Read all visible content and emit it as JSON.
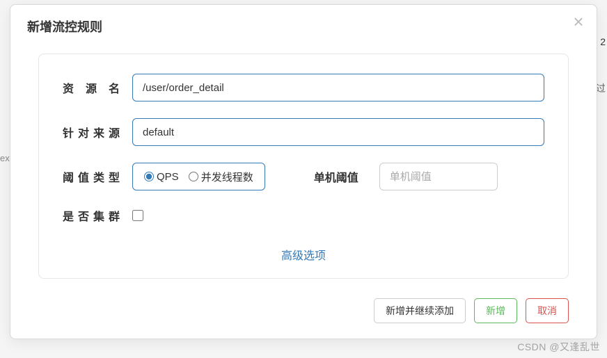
{
  "background": {
    "rightText1": "2",
    "rightText2": "过",
    "leftText": "ex"
  },
  "modal": {
    "title": "新增流控规则",
    "closeGlyph": "×",
    "form": {
      "resource": {
        "label": "资源名",
        "value": "/user/order_detail"
      },
      "origin": {
        "label": "针对来源",
        "value": "default"
      },
      "thresholdType": {
        "label": "阈值类型",
        "options": [
          {
            "label": "QPS",
            "checked": true
          },
          {
            "label": "并发线程数",
            "checked": false
          }
        ]
      },
      "thresholdValue": {
        "label": "单机阈值",
        "placeholder": "单机阈值",
        "value": ""
      },
      "cluster": {
        "label": "是否集群",
        "checked": false
      },
      "advanced": "高级选项"
    },
    "footer": {
      "addContinue": "新增并继续添加",
      "add": "新增",
      "cancel": "取消"
    }
  },
  "watermark": "CSDN @又逢乱世"
}
